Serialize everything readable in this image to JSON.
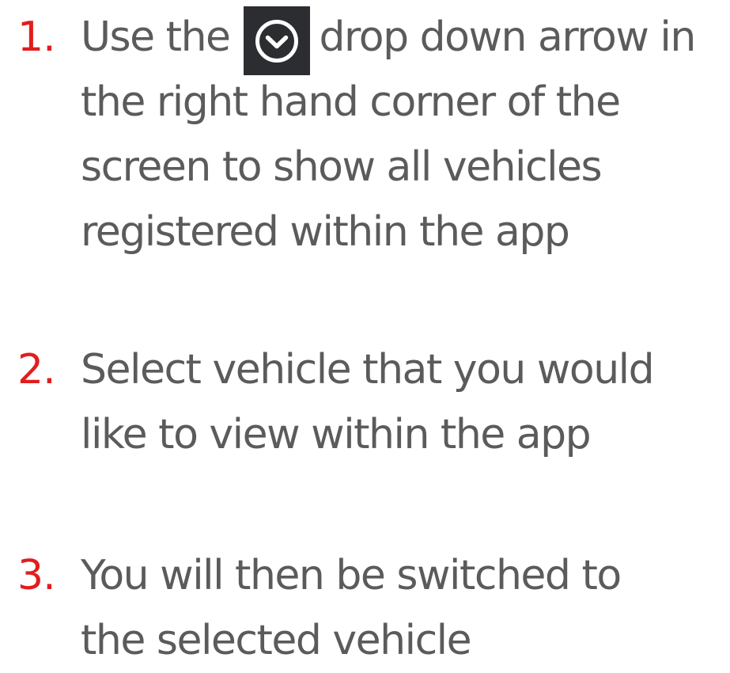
{
  "steps": [
    {
      "number": "1.",
      "lines": [
        "Use the",
        "drop down arrow in",
        "the right hand corner of the",
        "screen to show all vehicles",
        "registered within the app"
      ],
      "icon": "chevron-down-circle-icon"
    },
    {
      "number": "2.",
      "lines": [
        "Select vehicle that you would",
        "like to view within the app"
      ]
    },
    {
      "number": "3.",
      "lines": [
        "You will then be switched to",
        "the selected vehicle"
      ]
    }
  ],
  "colors": {
    "number": "#e21d1d",
    "text": "#5b5b5b",
    "icon_background": "#2b2d31",
    "icon_foreground": "#ffffff"
  }
}
